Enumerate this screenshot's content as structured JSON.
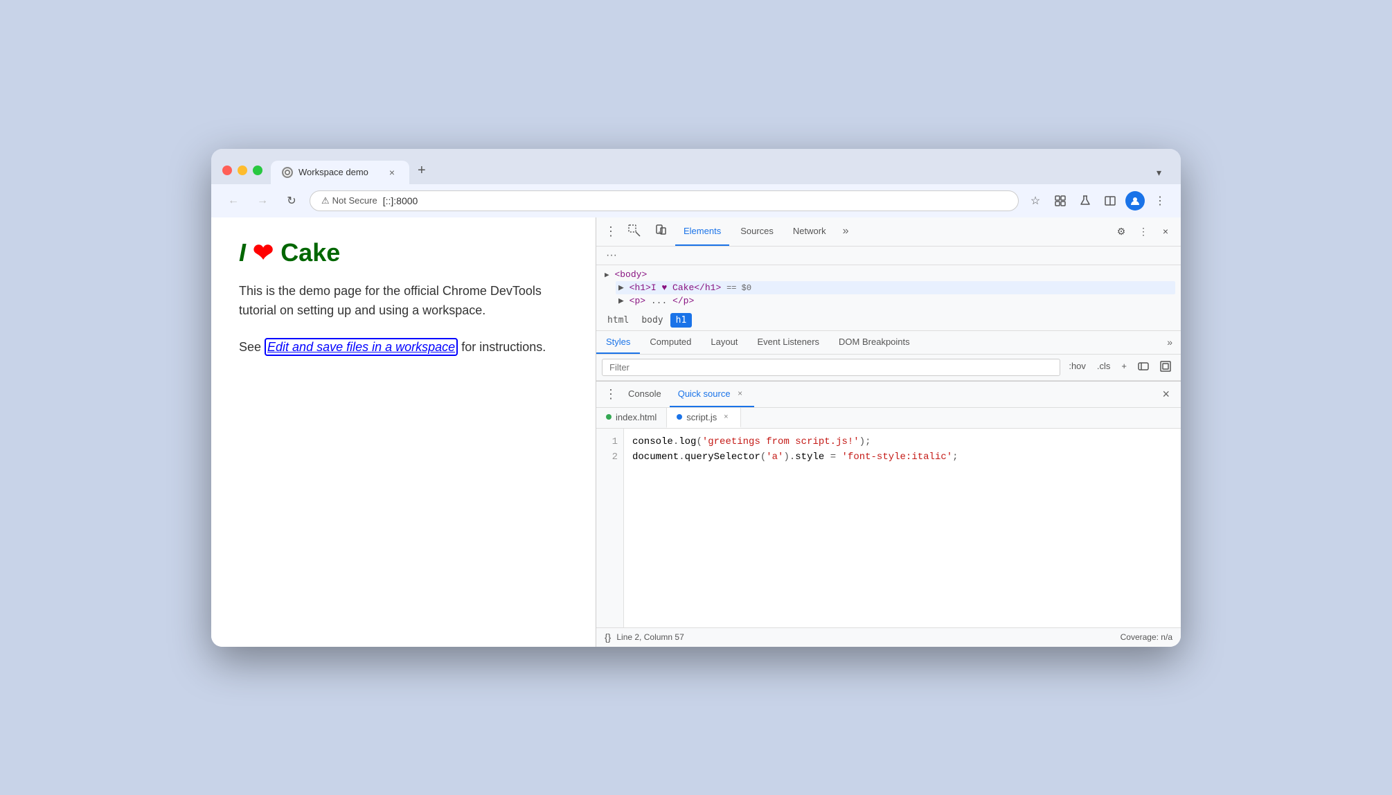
{
  "browser": {
    "traffic_lights": {
      "red": "red",
      "yellow": "yellow",
      "green": "green"
    },
    "tab": {
      "title": "Workspace demo",
      "close_label": "×",
      "new_tab_label": "+"
    },
    "tab_menu_label": "▾",
    "nav": {
      "back_label": "←",
      "forward_label": "→",
      "refresh_label": "↻",
      "security_label": "⚠ Not Secure",
      "url": "[::]:8000",
      "bookmark_icon": "☆",
      "extensions_icon": "⬡",
      "lab_icon": "⚗",
      "split_icon": "⬜",
      "profile_icon": "👤",
      "menu_icon": "⋮"
    }
  },
  "webpage": {
    "title_i": "I",
    "title_heart": "❤",
    "title_cake": "Cake",
    "body_text": "This is the demo page for the official Chrome DevTools tutorial on setting up and using a workspace.",
    "see_text": "See ",
    "link_text": "Edit and save files in a workspace",
    "after_link": " for instructions."
  },
  "devtools": {
    "menu_dots": "⋮",
    "inspect_icon": "⬚",
    "device_icon": "📱",
    "tabs": [
      {
        "label": "Elements",
        "active": true
      },
      {
        "label": "Sources",
        "active": false
      },
      {
        "label": "Network",
        "active": false
      }
    ],
    "tab_more": "»",
    "settings_icon": "⚙",
    "more_icon": "⋮",
    "close_icon": "×",
    "elements_tree": {
      "body_tag": "<body>",
      "h1_line": "<h1>I ♥ Cake</h1>",
      "h1_selected": true,
      "equals_label": "== $0",
      "p_tag": "<p>",
      "p_close_tag": "</p>"
    },
    "breadcrumb": {
      "html": "html",
      "body": "body",
      "h1": "h1",
      "active": "h1"
    },
    "styles": {
      "tabs": [
        {
          "label": "Styles",
          "active": true
        },
        {
          "label": "Computed",
          "active": false
        },
        {
          "label": "Layout",
          "active": false
        },
        {
          "label": "Event Listeners",
          "active": false
        },
        {
          "label": "DOM Breakpoints",
          "active": false
        }
      ],
      "tab_more": "»",
      "filter_placeholder": "Filter",
      "hov_label": ":hov",
      "cls_label": ".cls",
      "add_icon": "+",
      "toggle_icon": "⧉",
      "layout_icon": "⊡"
    },
    "bottom": {
      "menu_icon": "⋮",
      "tabs": [
        {
          "label": "Console",
          "active": false,
          "has_close": false
        },
        {
          "label": "Quick source",
          "active": true,
          "has_close": true
        }
      ],
      "close_icon": "×",
      "file_tabs": [
        {
          "name": "index.html",
          "dot": "green",
          "active": false
        },
        {
          "name": "script.js",
          "dot": "blue",
          "active": true,
          "has_close": true
        }
      ],
      "code": {
        "lines": [
          {
            "number": "1",
            "content": "console.log('greetings from script.js!');"
          },
          {
            "number": "2",
            "content": "document.querySelector('a').style = 'font-style:italic';"
          }
        ]
      },
      "status": {
        "format_icon": "{}",
        "position": "Line 2, Column 57",
        "coverage": "Coverage: n/a"
      }
    }
  }
}
